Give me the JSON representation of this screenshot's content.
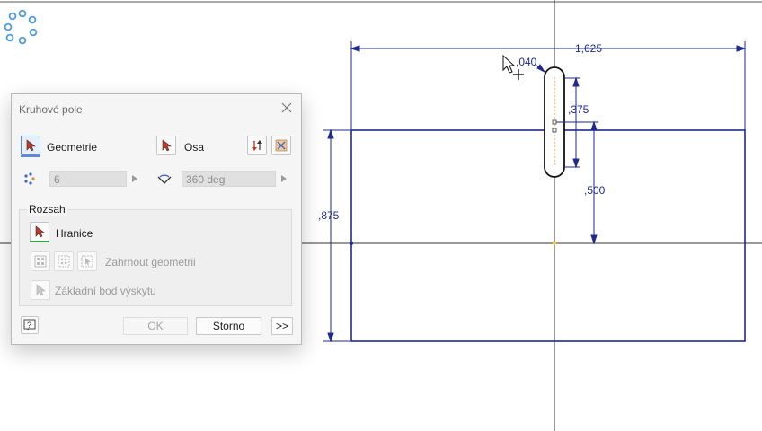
{
  "dimensions": {
    "width_total": "1,625",
    "slot_width": ",040",
    "slot_length": ",375",
    "offset": ",500",
    "height_total": ",875"
  },
  "dialog": {
    "title": "Kruhové pole",
    "geometry_label": "Geometrie",
    "axis_label": "Osa",
    "count_value": "6",
    "angle_value": "360 deg",
    "range_group_title": "Rozsah",
    "boundary_label": "Hranice",
    "include_geometry_label": "Zahrnout geometrii",
    "base_point_label": "Základní bod výskytu",
    "ok_label": "OK",
    "cancel_label": "Storno",
    "more_label": ">>"
  },
  "colors": {
    "sketch_blue": "#1f2a8c",
    "axis_line": "#333333",
    "dialog_bg": "#f5f5f5",
    "accent": "#5a8bd6"
  }
}
